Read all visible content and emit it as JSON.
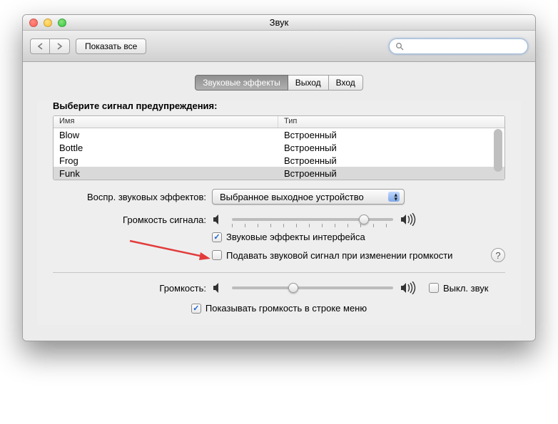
{
  "window_title": "Звук",
  "toolbar": {
    "show_all_label": "Показать все",
    "search_placeholder": ""
  },
  "tabs": [
    {
      "label": "Звуковые эффекты",
      "active": true
    },
    {
      "label": "Выход",
      "active": false
    },
    {
      "label": "Вход",
      "active": false
    }
  ],
  "alert_section_label": "Выберите сигнал предупреждения:",
  "table": {
    "columns": {
      "name": "Имя",
      "type": "Тип"
    },
    "rows": [
      {
        "name": "Blow",
        "type": "Встроенный",
        "selected": false
      },
      {
        "name": "Bottle",
        "type": "Встроенный",
        "selected": false
      },
      {
        "name": "Frog",
        "type": "Встроенный",
        "selected": false
      },
      {
        "name": "Funk",
        "type": "Встроенный",
        "selected": true
      }
    ]
  },
  "play_through_label": "Воспр. звуковых эффектов:",
  "play_through_value": "Выбранное выходное устройство",
  "alert_volume_label": "Громкость сигнала:",
  "alert_volume_pct": 82,
  "ui_sounds_label": "Звуковые эффекты интерфейса",
  "ui_sounds_checked": true,
  "feedback_label": "Подавать звуковой сигнал при изменении громкости",
  "feedback_checked": false,
  "output_volume_label": "Громкость:",
  "output_volume_pct": 38,
  "mute_label": "Выкл. звук",
  "mute_checked": false,
  "menubar_label": "Показывать громкость в строке меню",
  "menubar_checked": true,
  "help_char": "?"
}
